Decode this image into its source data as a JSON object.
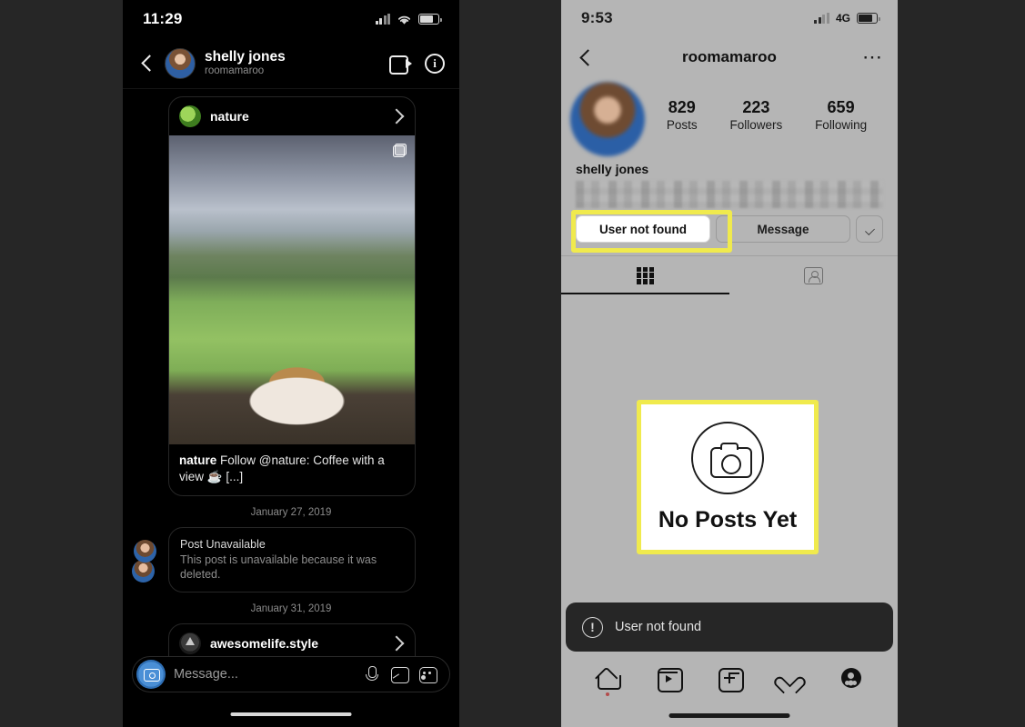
{
  "left_phone": {
    "status_bar": {
      "time": "11:29",
      "signal_icon": "cellular-bars-icon",
      "wifi_icon": "wifi-icon",
      "battery_icon": "battery-icon"
    },
    "header": {
      "back_icon": "back-chevron-icon",
      "avatar": "avatar",
      "display_name": "shelly jones",
      "username": "roomamaroo",
      "video_call_icon": "video-camera-icon",
      "info_icon": "info-circle-icon"
    },
    "thread": {
      "shared_post": {
        "account": "nature",
        "chevron_icon": "chevron-right-icon",
        "multi_photo_icon": "multi-photo-badge-icon",
        "caption_author": "nature",
        "caption_text": " Follow @nature: Coffee with a view ☕ [...]"
      },
      "date_1": "January 27, 2019",
      "unavailable_post": {
        "title": "Post Unavailable",
        "body": "This post is unavailable because it was deleted."
      },
      "date_2": "January 31, 2019",
      "shared_post_2": {
        "account": "awesomelife.style",
        "chevron_icon": "chevron-right-icon"
      }
    },
    "composer": {
      "camera_icon": "camera-button-icon",
      "placeholder": "Message...",
      "mic_icon": "microphone-icon",
      "gallery_icon": "gallery-icon",
      "sticker_icon": "sticker-icon"
    }
  },
  "right_phone": {
    "status_bar": {
      "time": "9:53",
      "signal_icon": "cellular-bars-icon",
      "network": "4G",
      "battery_icon": "battery-icon"
    },
    "header": {
      "back_icon": "back-chevron-icon",
      "title": "roomamaroo",
      "more_icon": "more-options-icon"
    },
    "profile": {
      "avatar": "profile-avatar",
      "stats": [
        {
          "value": "829",
          "label": "Posts"
        },
        {
          "value": "223",
          "label": "Followers"
        },
        {
          "value": "659",
          "label": "Following"
        }
      ],
      "display_name": "shelly jones",
      "bio": ""
    },
    "actions": {
      "primary_label": "User not found",
      "message_label": "Message",
      "more_icon": "chevron-down-icon"
    },
    "tabs": [
      {
        "icon": "grid-icon",
        "active": true
      },
      {
        "icon": "tagged-person-icon",
        "active": false
      }
    ],
    "empty_state": {
      "camera_icon": "camera-circle-icon",
      "text": "No Posts Yet"
    },
    "toast": {
      "icon": "exclamation-circle-icon",
      "text": "User not found"
    },
    "tabbar": [
      {
        "icon": "home-icon",
        "badge": true
      },
      {
        "icon": "reels-icon",
        "badge": false
      },
      {
        "icon": "create-post-icon",
        "badge": false
      },
      {
        "icon": "activity-heart-icon",
        "badge": false
      },
      {
        "icon": "profile-icon",
        "badge": false
      }
    ]
  },
  "annotations": {
    "highlight_color": "#f0ea4d",
    "boxes": [
      {
        "name": "user-not-found-button-highlight"
      },
      {
        "name": "no-posts-yet-highlight"
      }
    ]
  }
}
